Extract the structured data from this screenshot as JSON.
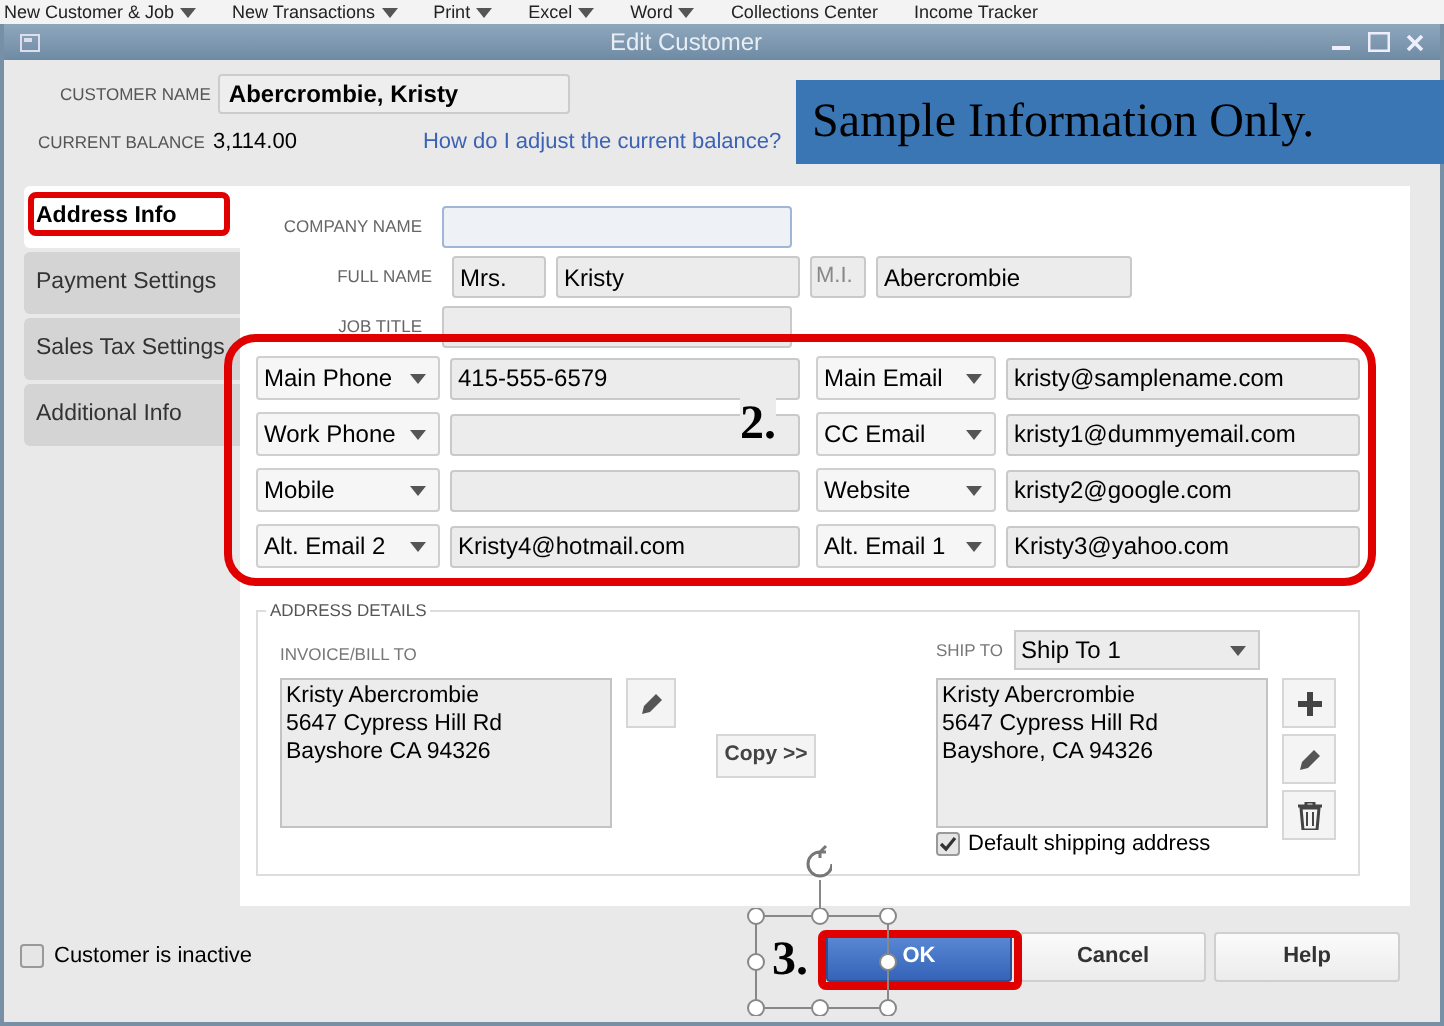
{
  "toolbar": [
    {
      "label": "New Customer & Job",
      "has_menu": true
    },
    {
      "label": "New Transactions",
      "has_menu": true
    },
    {
      "label": "Print",
      "has_menu": true
    },
    {
      "label": "Excel",
      "has_menu": true
    },
    {
      "label": "Word",
      "has_menu": true
    },
    {
      "label": "Collections Center",
      "has_menu": false
    },
    {
      "label": "Income Tracker",
      "has_menu": false
    }
  ],
  "window": {
    "title": "Edit Customer"
  },
  "customer_name": {
    "label": "CUSTOMER NAME",
    "value": "Abercrombie, Kristy"
  },
  "current_balance": {
    "label": "CURRENT BALANCE",
    "value": "3,114.00"
  },
  "balance_help_link": "How do I adjust the current balance?",
  "banner": "Sample Information Only.",
  "tabs": [
    {
      "label": "Address Info",
      "selected": true
    },
    {
      "label": "Payment Settings",
      "selected": false
    },
    {
      "label": "Sales Tax Settings",
      "selected": false
    },
    {
      "label": "Additional Info",
      "selected": false
    }
  ],
  "company_name": {
    "label": "COMPANY NAME"
  },
  "full_name": {
    "label": "FULL NAME",
    "title": "Mrs.",
    "first": "Kristy",
    "middle_placeholder": "M.I.",
    "last": "Abercrombie"
  },
  "job_title": {
    "label": "JOB TITLE"
  },
  "contact_rows": [
    {
      "left": {
        "type": "Main Phone",
        "value": "415-555-6579"
      },
      "right": {
        "type": "Main Email",
        "value": "kristy@samplename.com"
      }
    },
    {
      "left": {
        "type": "Work Phone"
      },
      "right": {
        "type": "CC Email",
        "value": "kristy1@dummyemail.com"
      }
    },
    {
      "left": {
        "type": "Mobile"
      },
      "right": {
        "type": "Website",
        "value": "kristy2@google.com"
      }
    },
    {
      "left": {
        "type": "Alt. Email 2",
        "value": "Kristy4@hotmail.com"
      },
      "right": {
        "type": "Alt. Email 1",
        "value": "Kristy3@yahoo.com"
      }
    }
  ],
  "address_details": {
    "title": "ADDRESS DETAILS",
    "bill_to_label": "INVOICE/BILL TO",
    "bill_to_lines": [
      "Kristy Abercrombie",
      "5647 Cypress Hill Rd",
      "Bayshore CA 94326"
    ],
    "copy_button": "Copy >>",
    "ship_to_label": "SHIP TO",
    "ship_to_select": "Ship To 1",
    "ship_to_lines": [
      "Kristy Abercrombie",
      "5647 Cypress Hill Rd",
      "Bayshore, CA 94326"
    ],
    "default_shipping": {
      "label": "Default shipping address",
      "checked": true
    }
  },
  "inactive": {
    "label": "Customer is inactive",
    "checked": false
  },
  "buttons": [
    {
      "label": "OK",
      "kind": "primary"
    },
    {
      "label": "Cancel",
      "kind": "default"
    },
    {
      "label": "Help",
      "kind": "default"
    }
  ],
  "annotations": [
    {
      "label": "2."
    },
    {
      "label": "3."
    }
  ]
}
